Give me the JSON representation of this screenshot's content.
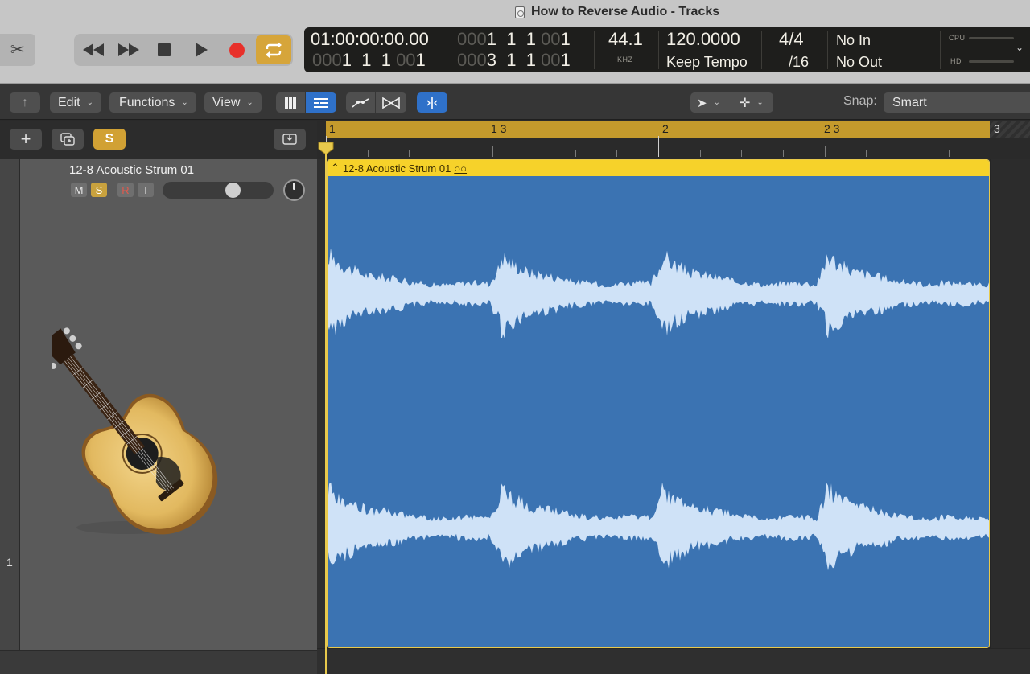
{
  "window": {
    "title": "How to Reverse Audio - Tracks"
  },
  "transport": {
    "rewind_icon": "rewind-icon",
    "forward_icon": "fast-forward-icon",
    "stop_icon": "stop-icon",
    "play_icon": "play-icon",
    "record_icon": "record-icon",
    "cycle_icon": "cycle-icon"
  },
  "lcd": {
    "timecode": "01:00:00:00.00",
    "position_top": {
      "dim1": "000",
      "bar": "1",
      "beat": "1",
      "div": "1",
      "dim2": "00",
      "tick": "1"
    },
    "position_bottom_left": {
      "dim1": "000",
      "bar": "1",
      "beat": "1",
      "div": "1",
      "dim2": "00",
      "tick": "1"
    },
    "position_bottom_right": {
      "dim1": "000",
      "bar": "3",
      "beat": "1",
      "div": "1",
      "dim2": "00",
      "tick": "1"
    },
    "sample_rate": "44.1",
    "sample_rate_unit": "KHZ",
    "tempo": "120.0000",
    "tempo_mode": "Keep Tempo",
    "time_signature": "4/4",
    "division": "/16",
    "in_point": "No In",
    "out_point": "No Out",
    "cpu_label": "CPU",
    "hd_label": "HD"
  },
  "controlbar": {
    "edit_label": "Edit",
    "functions_label": "Functions",
    "view_label": "View",
    "snap_label": "Snap:",
    "snap_value": "Smart"
  },
  "track": {
    "number": "1",
    "name": "12-8 Acoustic Strum 01",
    "mute_label": "M",
    "solo_label": "S",
    "record_label": "R",
    "input_label": "I",
    "volume_level": 0.66,
    "icon": "acoustic-guitar-icon"
  },
  "header_buttons": {
    "add_label": "+",
    "solo_label": "S"
  },
  "ruler": {
    "bar1": "1",
    "bar1_3": "1 3",
    "bar2": "2",
    "bar2_3": "2 3",
    "bar3": "3"
  },
  "region": {
    "name": "12-8 Acoustic Strum 01",
    "color": "#3b73b2",
    "header_color": "#f6d22a"
  }
}
